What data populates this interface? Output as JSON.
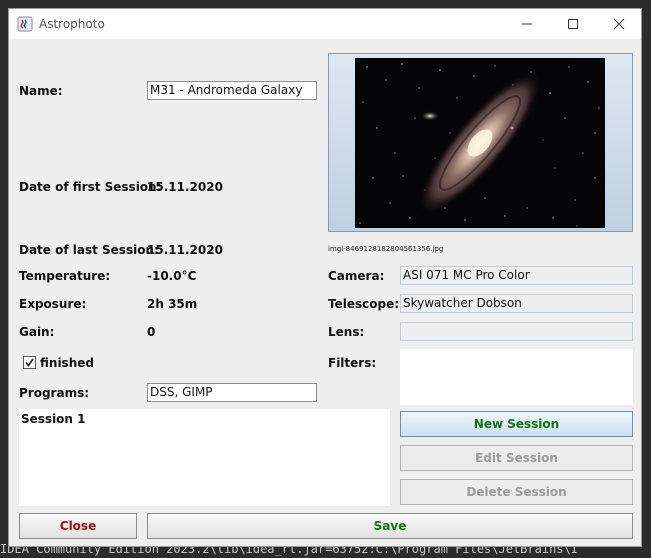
{
  "ide_text": "IDEA Community Edition 2023.2\\lib\\idea_rt.jar=63752:C:\\Program Files\\JetBrains\\I",
  "window": {
    "title": "Astrophoto"
  },
  "form": {
    "name_label": "Name:",
    "name_value": "M31 - Andromeda Galaxy",
    "first_session_label": "Date of first Session:",
    "first_session_value": "15.11.2020",
    "last_session_label": "Date of last Session:",
    "last_session_value": "15.11.2020",
    "temperature_label": "Temperature:",
    "temperature_value": "-10.0°C",
    "exposure_label": "Exposure:",
    "exposure_value": "2h 35m",
    "gain_label": "Gain:",
    "gain_value": "0",
    "finished_label": "finished",
    "finished_checked": true,
    "programs_label": "Programs:",
    "programs_value": "DSS, GIMP",
    "sessions": [
      "Session 1"
    ]
  },
  "image": {
    "filename": "imgl-8469128182804561356.jpg"
  },
  "equipment": {
    "camera_label": "Camera:",
    "camera_value": "ASI 071 MC Pro Color",
    "telescope_label": "Telescope:",
    "telescope_value": "Skywatcher Dobson",
    "lens_label": "Lens:",
    "lens_value": "",
    "filters_label": "Filters:"
  },
  "buttons": {
    "new_session": "New Session",
    "edit_session": "Edit Session",
    "delete_session": "Delete Session",
    "close": "Close",
    "save": "Save"
  }
}
